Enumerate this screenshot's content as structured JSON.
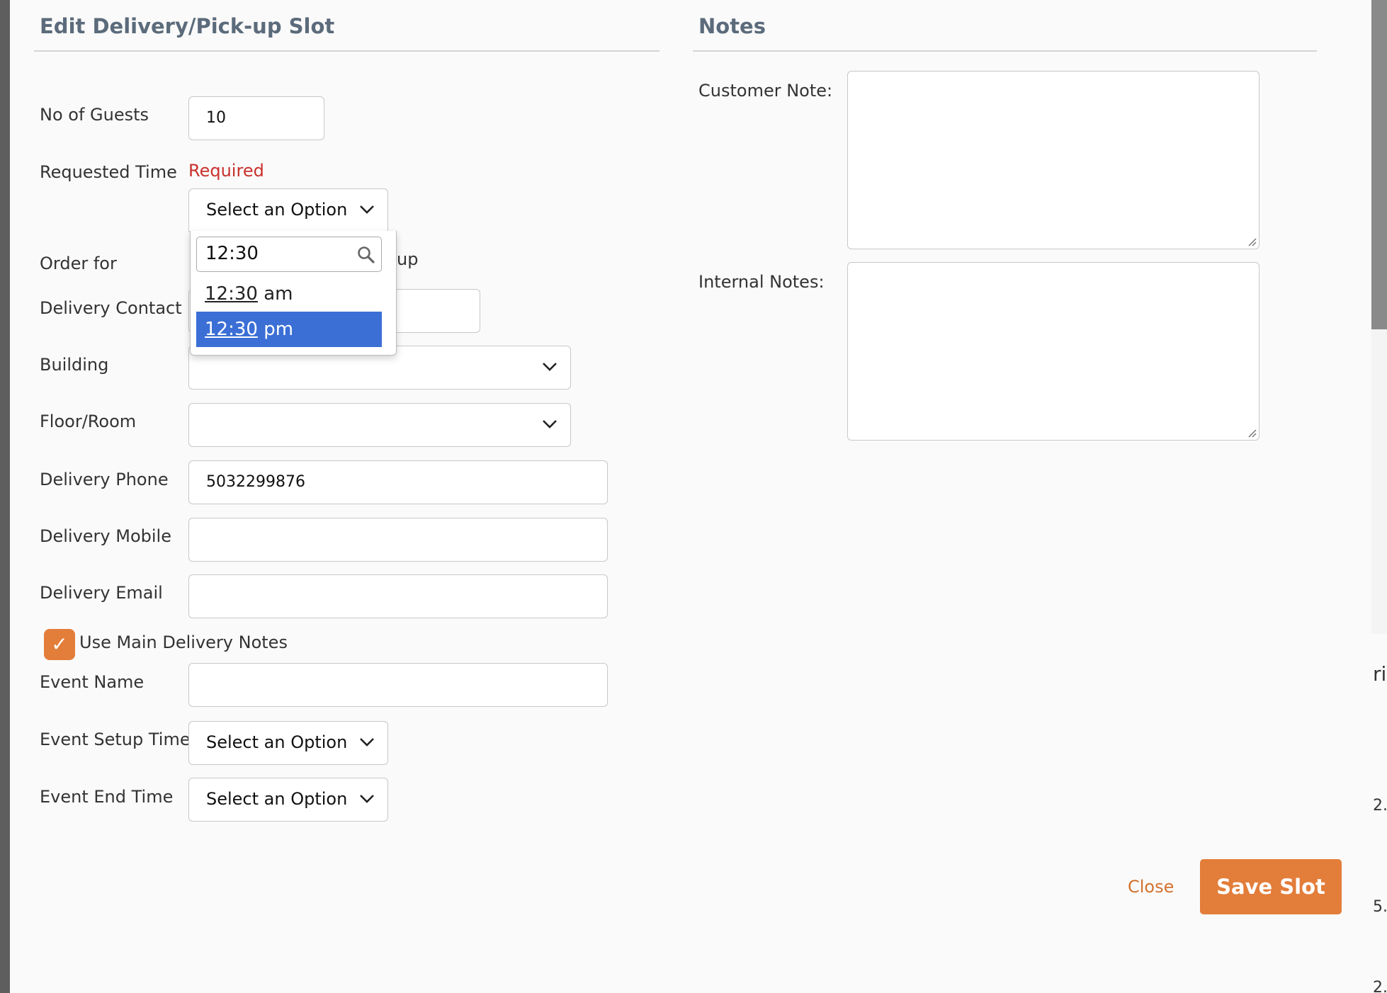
{
  "modal": {
    "title": "Edit Delivery/Pick-up Slot",
    "notes_title": "Notes"
  },
  "form": {
    "guests": {
      "label": "No of Guests",
      "value": "10"
    },
    "requested_time": {
      "label": "Requested Time",
      "required": "Required",
      "select_value": "Select an Option",
      "search_value": "12:30",
      "options": [
        {
          "match": "12:30",
          "rest": " am"
        },
        {
          "match": "12:30",
          "rest": " pm"
        }
      ],
      "highlighted_option": "12:30 pm"
    },
    "order_for": {
      "label": "Order for",
      "partial_text": "up"
    },
    "delivery_contact": {
      "label": "Delivery Contact",
      "value": ""
    },
    "building": {
      "label": "Building",
      "value": ""
    },
    "floor_room": {
      "label": "Floor/Room",
      "value": ""
    },
    "delivery_phone": {
      "label": "Delivery Phone",
      "value": "5032299876"
    },
    "delivery_mobile": {
      "label": "Delivery Mobile",
      "value": ""
    },
    "delivery_email": {
      "label": "Delivery Email",
      "value": ""
    },
    "use_main_notes": {
      "label": "Use Main Delivery Notes",
      "checked": true,
      "check_glyph": "✓"
    },
    "event_name": {
      "label": "Event Name",
      "value": ""
    },
    "event_setup_time": {
      "label": "Event Setup Time",
      "value": "Select an Option"
    },
    "event_end_time": {
      "label": "Event End Time",
      "value": "Select an Option"
    }
  },
  "notes": {
    "customer_note_label": "Customer Note:",
    "internal_notes_label": "Internal Notes:"
  },
  "actions": {
    "close_label": "Close",
    "save_label": "Save Slot"
  },
  "background_fragments": [
    "ric",
    "2.",
    "5.",
    "2."
  ],
  "colors": {
    "accent": "#e37d3a",
    "link": "#d4722e",
    "required": "#c9302c",
    "title": "#5b6b7b",
    "highlight": "#3b6fd6"
  }
}
